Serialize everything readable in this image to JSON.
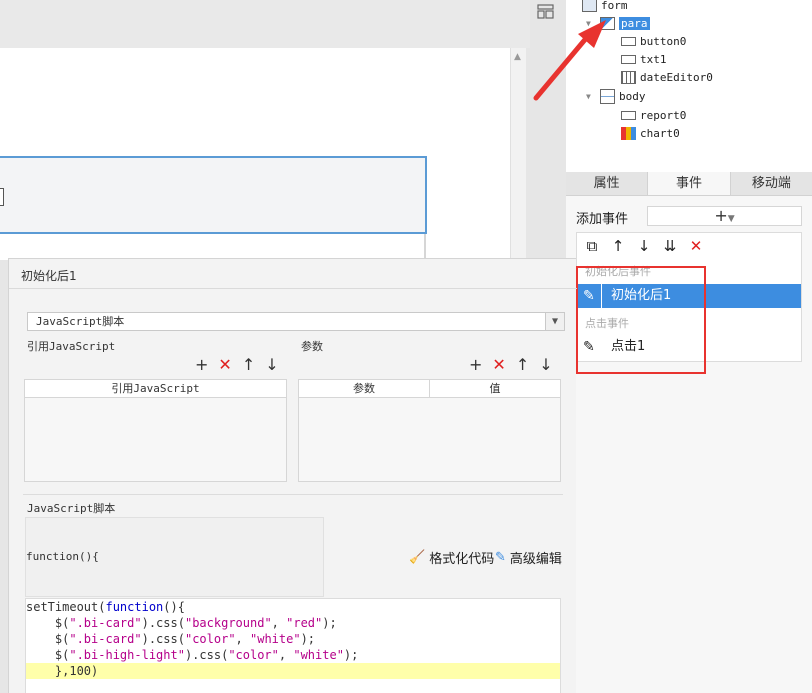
{
  "tree": {
    "nodes": [
      {
        "label": "form"
      },
      {
        "label": "para"
      },
      {
        "label": "button0"
      },
      {
        "label": "txt1"
      },
      {
        "label": "dateEditor0"
      },
      {
        "label": "body"
      },
      {
        "label": "report0"
      },
      {
        "label": "chart0"
      }
    ]
  },
  "tabs": [
    "属性",
    "事件",
    "移动端"
  ],
  "events": {
    "add_label": "添加事件",
    "add_button": "+",
    "categories": [
      "初始化后事件",
      "点击事件"
    ],
    "items": [
      "初始化后1",
      "点击1"
    ]
  },
  "dialog": {
    "title": "初始化后1",
    "type_value": "JavaScript脚本",
    "ref_js_label": "引用JavaScript",
    "params_label": "参数",
    "ref_js_column": "引用JavaScript",
    "param_column": "参数",
    "value_column": "值",
    "script_label": "JavaScript脚本",
    "function_header": "function(){",
    "format_code": "格式化代码",
    "advanced_edit": "高级编辑",
    "code_lines": [
      "setTimeout(function(){",
      "    $(\".bi-card\").css(\"background\", \"red\");",
      "    $(\".bi-card\").css(\"color\", \"white\");",
      "    $(\".bi-high-light\").css(\"color\", \"white\");",
      "    },100)"
    ]
  },
  "colors": {
    "selection": "#3d8de0",
    "annotation_red": "#e8332f",
    "highlight_line": "#ffffaa"
  }
}
